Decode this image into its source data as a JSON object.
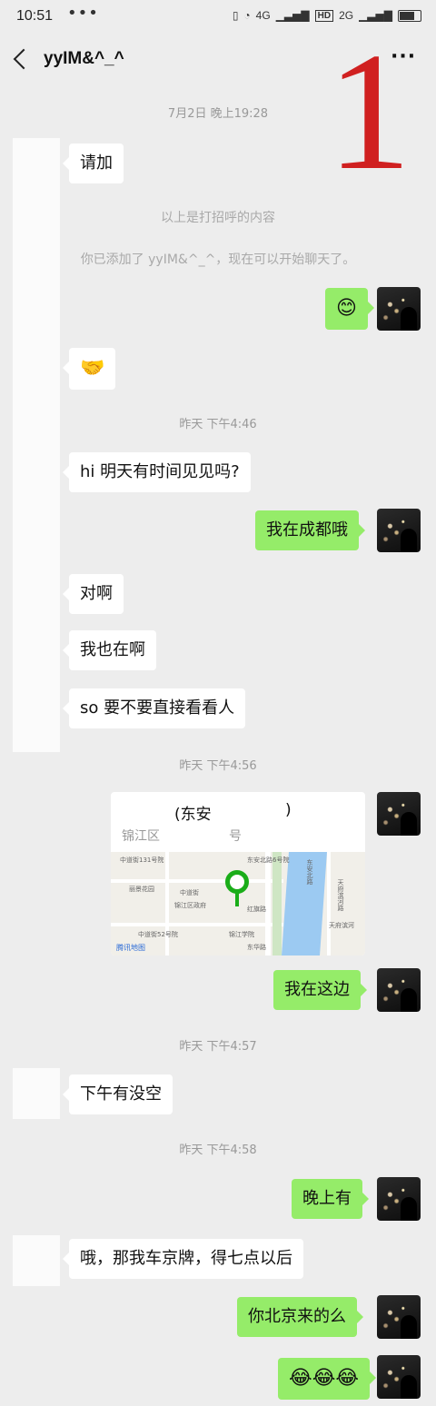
{
  "status": {
    "time": "10:51",
    "dots": "•••",
    "net1": "4G",
    "hd": "HD",
    "net2": "2G"
  },
  "header": {
    "title": "yyIM&^_^",
    "overlay_number": "1"
  },
  "timestamps": [
    "7月2日 晚上19:28",
    "昨天 下午4:46",
    "昨天 下午4:56",
    "昨天 下午4:57",
    "昨天 下午4:58"
  ],
  "system_messages": [
    "以上是打招呼的内容",
    "你已添加了 yyIM&^_^，现在可以开始聊天了。"
  ],
  "messages": [
    {
      "side": "left",
      "text": "请加"
    },
    {
      "side": "right",
      "text": "😊"
    },
    {
      "side": "left",
      "text": "🤝"
    },
    {
      "side": "left",
      "text": "hi 明天有时间见见吗?"
    },
    {
      "side": "right",
      "text": "我在成都哦"
    },
    {
      "side": "left",
      "text": "对啊"
    },
    {
      "side": "left",
      "text": "我也在啊"
    },
    {
      "side": "left",
      "text": "so 要不要直接看看人"
    },
    {
      "side": "right",
      "text": "我在这边"
    },
    {
      "side": "left",
      "text": "下午有没空"
    },
    {
      "side": "right",
      "text": "晚上有"
    },
    {
      "side": "left",
      "text": "哦，那我车京牌，得七点以后"
    },
    {
      "side": "right",
      "text": "你北京来的么"
    },
    {
      "side": "right",
      "text": "😂😂😂"
    }
  ],
  "location": {
    "name": "(东安",
    "name_tail": ")",
    "address": "锦江区",
    "address_tail": "号",
    "map_labels": [
      "中道街131号院",
      "东安北路6号院",
      "东安北路",
      "天府滨河路",
      "丽景花园",
      "中道街",
      "锦江区政府",
      "红旗路",
      "中道街52号院",
      "天府滨河",
      "锦江学院",
      "东华路"
    ],
    "map_logo": "腾讯地图"
  }
}
